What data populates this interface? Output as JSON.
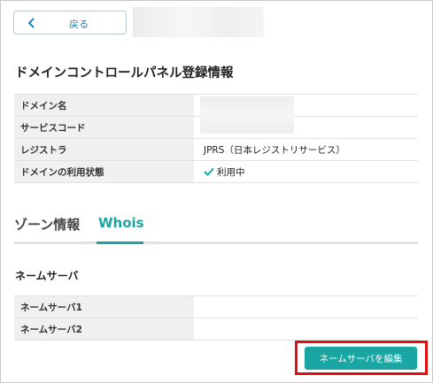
{
  "header": {
    "back_label": "戻る"
  },
  "page_title": "ドメインコントロールパネル登録情報",
  "domain_info": [
    {
      "key": "ドメイン名",
      "value": ""
    },
    {
      "key": "サービスコード",
      "value": ""
    },
    {
      "key": "レジストラ",
      "value": "JPRS（日本レジストリサービス）"
    },
    {
      "key": "ドメインの利用状態",
      "value": "利用中"
    }
  ],
  "tabs": [
    {
      "label": "ゾーン情報",
      "active": false
    },
    {
      "label": "Whois",
      "active": true
    }
  ],
  "nameserver_section": {
    "title": "ネームサーバ",
    "rows": [
      {
        "key": "ネームサーバ1",
        "value": ""
      },
      {
        "key": "ネームサーバ2",
        "value": ""
      }
    ],
    "edit_button_label": "ネームサーバを編集"
  },
  "colors": {
    "accent": "#1aa6a3",
    "link": "#1f7fbf",
    "highlight": "#e01010",
    "label_bg": "#f0f0f3"
  },
  "icons": {
    "back": "chevron-left-icon",
    "status": "check-icon"
  }
}
